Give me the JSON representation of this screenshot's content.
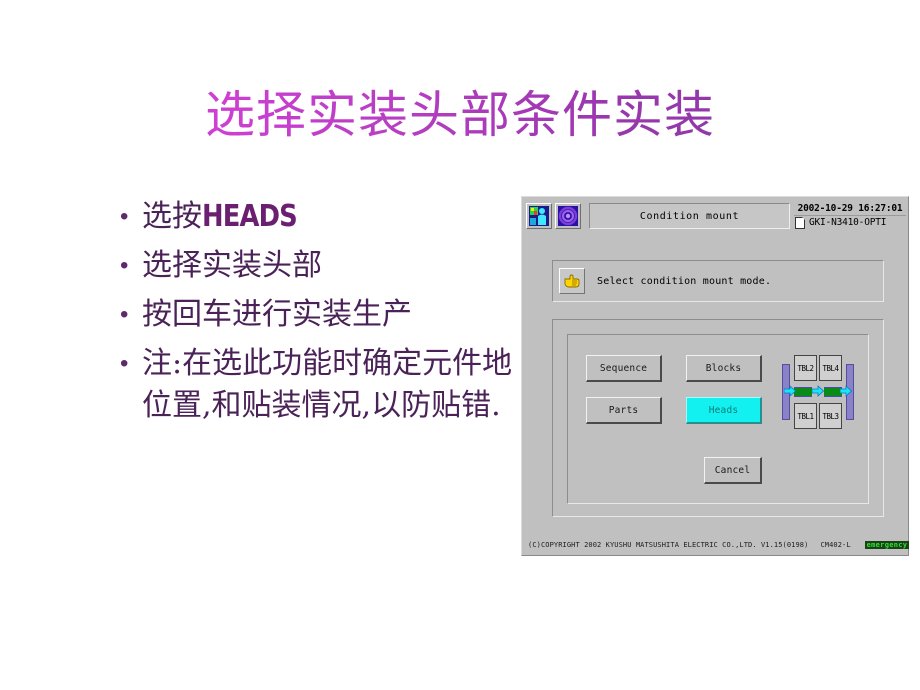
{
  "slide": {
    "title": "选择实装头部条件实装",
    "bullets": [
      {
        "pre": "选按",
        "strong": "HEADS",
        "post": ""
      },
      {
        "pre": "选择实装头部",
        "strong": "",
        "post": ""
      },
      {
        "pre": "按回车进行实装生产",
        "strong": "",
        "post": ""
      },
      {
        "pre": "注:在选此功能时确定元件地位置,和贴装情况,以防贴错.",
        "strong": "",
        "post": ""
      }
    ],
    "title_gradient_from": "#e040e0",
    "title_gradient_to": "#7d3b9c",
    "bullet_color": "#4a2257"
  },
  "machine_panel": {
    "titlebar": {
      "window_title": "Condition mount",
      "datetime": "2002-10-29  16:27:01",
      "filename": "GKI-N3410-OPTI",
      "icon_left": "operator-icon",
      "icon_right": "spiral-icon",
      "file_icon": "document-icon"
    },
    "message": {
      "icon": "pointing-hand-icon",
      "text": "Select condition mount mode."
    },
    "buttons": [
      {
        "id": "sequence",
        "label": "Sequence",
        "selected": false
      },
      {
        "id": "blocks",
        "label": "Blocks",
        "selected": false
      },
      {
        "id": "parts",
        "label": "Parts",
        "selected": false
      },
      {
        "id": "heads",
        "label": "Heads",
        "selected": true
      }
    ],
    "cancel_label": "Cancel",
    "table_diagram": {
      "cells": [
        "TBL2",
        "TBL4",
        "TBL1",
        "TBL3"
      ],
      "rail_color": "#8a82c8",
      "conveyor_color": "#0a8a18",
      "arrow_color": "#13e8f0"
    },
    "footer": {
      "copyright": "(C)COPYRIGHT 2002 KYUSHU MATSUSHITA ELECTRIC CO.,LTD.  V1.15(0198)",
      "model": "CM402-L",
      "status": "emergency",
      "status_color": "#23e823",
      "selected_color": "#13f0f0"
    }
  }
}
